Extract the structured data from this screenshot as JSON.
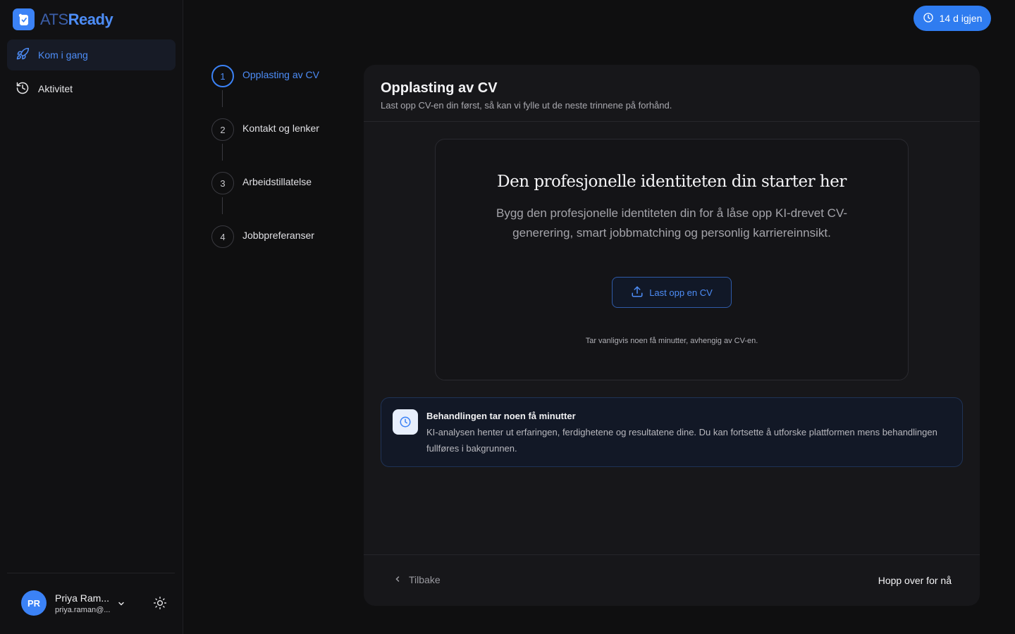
{
  "app": {
    "logo_ats": "ATS",
    "logo_ready": "Ready",
    "trial_label": "14 d igjen"
  },
  "sidebar": {
    "items": [
      {
        "label": "Kom i gang",
        "icon": "rocket-icon",
        "active": true
      },
      {
        "label": "Aktivitet",
        "icon": "history-icon",
        "active": false
      }
    ],
    "user": {
      "initials": "PR",
      "name": "Priya Ram...",
      "email": "priya.raman@..."
    }
  },
  "stepper": {
    "steps": [
      {
        "number": "1",
        "label": "Opplasting av CV",
        "active": true
      },
      {
        "number": "2",
        "label": "Kontakt og lenker",
        "active": false
      },
      {
        "number": "3",
        "label": "Arbeidstillatelse",
        "active": false
      },
      {
        "number": "4",
        "label": "Jobbpreferanser",
        "active": false
      }
    ]
  },
  "card": {
    "title": "Opplasting av CV",
    "subtitle": "Last opp CV-en din først, så kan vi fylle ut de neste trinnene på forhånd.",
    "upload": {
      "heading": "Den profesjonelle identiteten din starter her",
      "description": "Bygg den profesjonelle identiteten din for å låse opp KI-drevet CV-generering, smart jobbmatching og personlig karriereinnsikt.",
      "button_label": "Last opp en CV",
      "note": "Tar vanligvis noen få minutter, avhengig av CV-en."
    },
    "info": {
      "title": "Behandlingen tar noen få minutter",
      "text": "KI-analysen henter ut erfaringen, ferdighetene og resultatene dine. Du kan fortsette å utforske plattformen mens behandlingen fullføres i bakgrunnen."
    },
    "footer": {
      "back_label": "Tilbake",
      "skip_label": "Hopp over for nå"
    }
  },
  "colors": {
    "accent": "#3b82f6",
    "background": "#0f0f10",
    "card": "#17171a"
  }
}
